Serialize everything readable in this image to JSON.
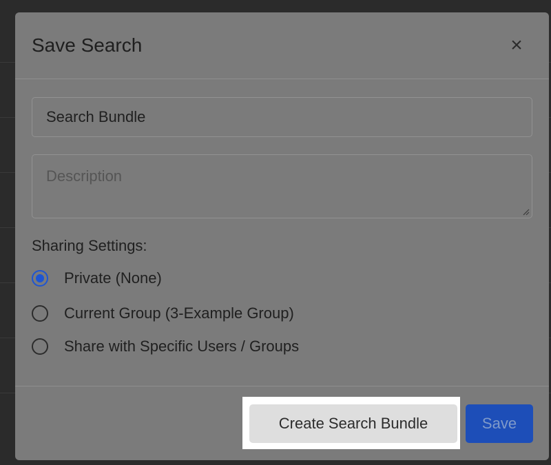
{
  "modal": {
    "title": "Save Search",
    "close_icon": "close-icon",
    "close_symbol": "×"
  },
  "form": {
    "name_value": "Search Bundle",
    "description_placeholder": "Description",
    "description_value": ""
  },
  "sharing": {
    "label": "Sharing Settings:",
    "options": [
      {
        "label": "Private (None)",
        "selected": true
      },
      {
        "label": "Current Group (3-Example Group)",
        "selected": false
      },
      {
        "label": "Share with Specific Users / Groups",
        "selected": false
      }
    ]
  },
  "footer": {
    "create_bundle_label": "Create Search Bundle",
    "save_label": "Save"
  },
  "colors": {
    "overlay": "#7b7b7b",
    "accent": "#1e55d2",
    "save_button": "#1d4eb8",
    "highlight": "#ffffff"
  }
}
